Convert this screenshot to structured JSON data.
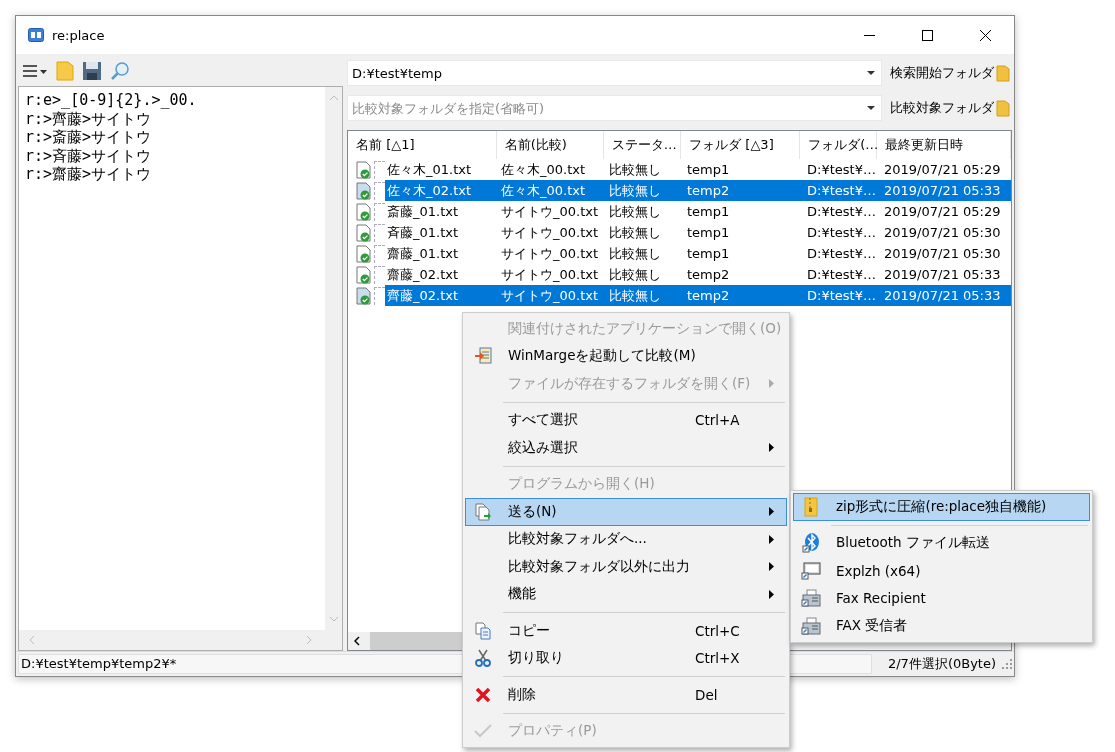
{
  "window": {
    "title": "re:place"
  },
  "script_lines": [
    "r:e>_[0-9]{2}.>_00.",
    "r:>齊藤>サイトウ",
    "r:>斎藤>サイトウ",
    "r:>斉藤>サイトウ",
    "r:>齋藤>サイトウ"
  ],
  "search_folder": {
    "value": "D:¥test¥temp",
    "button": "検索開始フォルダ"
  },
  "compare_folder": {
    "placeholder": "比較対象フォルダを指定(省略可)",
    "button": "比較対象フォルダ"
  },
  "table": {
    "columns": [
      "名前 [△1]",
      "名前(比較)",
      "ステータ…",
      "フォルダ [△3]",
      "フォルダ(…",
      "最終更新日時"
    ],
    "rows": [
      {
        "selected": false,
        "cells": [
          "佐々木_01.txt",
          "佐々木_00.txt",
          "比較無し",
          "temp1",
          "D:¥test¥…",
          "2019/07/21 05:29"
        ]
      },
      {
        "selected": true,
        "cells": [
          "佐々木_02.txt",
          "佐々木_00.txt",
          "比較無し",
          "temp2",
          "D:¥test¥…",
          "2019/07/21 05:33"
        ]
      },
      {
        "selected": false,
        "cells": [
          "斎藤_01.txt",
          "サイトウ_00.txt",
          "比較無し",
          "temp1",
          "D:¥test¥…",
          "2019/07/21 05:29"
        ]
      },
      {
        "selected": false,
        "cells": [
          "斉藤_01.txt",
          "サイトウ_00.txt",
          "比較無し",
          "temp1",
          "D:¥test¥…",
          "2019/07/21 05:30"
        ]
      },
      {
        "selected": false,
        "cells": [
          "齋藤_01.txt",
          "サイトウ_00.txt",
          "比較無し",
          "temp1",
          "D:¥test¥…",
          "2019/07/21 05:30"
        ]
      },
      {
        "selected": false,
        "cells": [
          "齋藤_02.txt",
          "サイトウ_00.txt",
          "比較無し",
          "temp2",
          "D:¥test¥…",
          "2019/07/21 05:33"
        ]
      },
      {
        "selected": true,
        "cells": [
          "齊藤_02.txt",
          "サイトウ_00.txt",
          "比較無し",
          "temp2",
          "D:¥test¥…",
          "2019/07/21 05:33"
        ]
      }
    ]
  },
  "context_menu": [
    {
      "kind": "item",
      "label": "関連付けされたアプリケーションで開く(O)",
      "disabled": true,
      "submenu": false,
      "selected": false
    },
    {
      "kind": "item",
      "label": "WinMargeを起動して比較(M)",
      "disabled": false,
      "submenu": false,
      "selected": false
    },
    {
      "kind": "item",
      "label": "ファイルが存在するフォルダを開く(F)",
      "disabled": true,
      "submenu": true,
      "selected": false
    },
    {
      "kind": "separator"
    },
    {
      "kind": "item",
      "label": "すべて選択",
      "shortcut": "Ctrl+A",
      "disabled": false,
      "submenu": false,
      "selected": false
    },
    {
      "kind": "item",
      "label": "絞込み選択",
      "disabled": false,
      "submenu": true,
      "selected": false
    },
    {
      "kind": "separator"
    },
    {
      "kind": "item",
      "label": "プログラムから開く(H)",
      "disabled": true,
      "submenu": false,
      "selected": false
    },
    {
      "kind": "item",
      "label": "送る(N)",
      "disabled": false,
      "submenu": true,
      "selected": true
    },
    {
      "kind": "item",
      "label": "比較対象フォルダへ...",
      "disabled": false,
      "submenu": true,
      "selected": false
    },
    {
      "kind": "item",
      "label": "比較対象フォルダ以外に出力",
      "disabled": false,
      "submenu": true,
      "selected": false
    },
    {
      "kind": "item",
      "label": "機能",
      "disabled": false,
      "submenu": true,
      "selected": false
    },
    {
      "kind": "separator"
    },
    {
      "kind": "item",
      "label": "コピー",
      "shortcut": "Ctrl+C",
      "disabled": false,
      "submenu": false,
      "selected": false
    },
    {
      "kind": "item",
      "label": "切り取り",
      "shortcut": "Ctrl+X",
      "disabled": false,
      "submenu": false,
      "selected": false
    },
    {
      "kind": "separator"
    },
    {
      "kind": "item",
      "label": "削除",
      "shortcut": "Del",
      "disabled": false,
      "submenu": false,
      "selected": false
    },
    {
      "kind": "separator"
    },
    {
      "kind": "item",
      "label": "プロパティ(P)",
      "disabled": true,
      "submenu": false,
      "selected": false
    }
  ],
  "send_to_menu": [
    {
      "kind": "item",
      "label": "zip形式に圧縮(re:place独自機能)",
      "selected": true
    },
    {
      "kind": "separator"
    },
    {
      "kind": "item",
      "label": "Bluetooth ファイル転送",
      "selected": false
    },
    {
      "kind": "item",
      "label": "Explzh (x64)",
      "selected": false
    },
    {
      "kind": "item",
      "label": "Fax Recipient",
      "selected": false
    },
    {
      "kind": "item",
      "label": "FAX 受信者",
      "selected": false
    }
  ],
  "status_bar": {
    "path": "D:¥test¥temp¥temp2¥*",
    "selection": "2/7件選択(0Byte)"
  }
}
